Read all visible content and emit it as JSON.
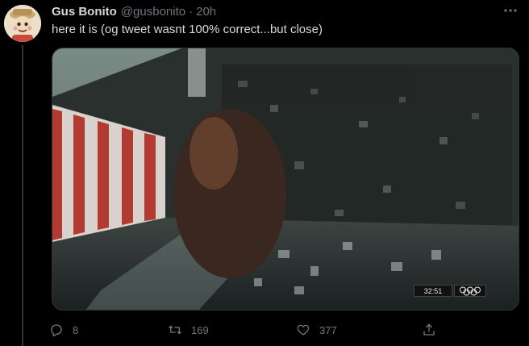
{
  "tweet": {
    "display_name": "Gus Bonito",
    "handle": "@gusbonito",
    "separator": "·",
    "time": "20h",
    "text": "here it is (og tweet wasnt 100% correct...but close)",
    "avatar_icon": "cartoon-avatar",
    "more_icon": "more-horizontal-icon"
  },
  "media": {
    "video_timestamp": "32:51",
    "broadcast_logo": "olympic-rings-icon"
  },
  "actions": {
    "reply": {
      "icon": "reply-icon",
      "count": "8"
    },
    "retweet": {
      "icon": "retweet-icon",
      "count": "169"
    },
    "like": {
      "icon": "heart-icon",
      "count": "377"
    },
    "share": {
      "icon": "share-icon"
    }
  },
  "colors": {
    "background": "#000000",
    "text_primary": "#d9d9d9",
    "text_secondary": "#6e767d",
    "divider": "#2f3336"
  }
}
